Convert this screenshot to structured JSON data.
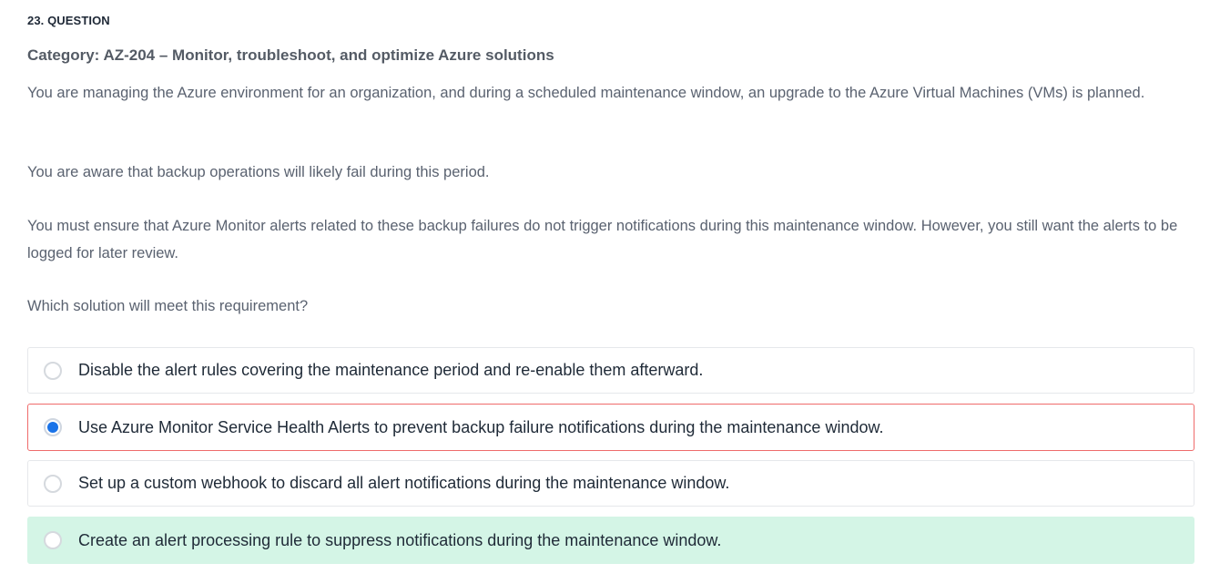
{
  "question": {
    "number_label": "23. QUESTION",
    "category": "Category: AZ-204 – Monitor, troubleshoot, and optimize Azure solutions",
    "paragraphs": [
      "You are managing the Azure environment for an organization, and during a scheduled maintenance window, an upgrade to the Azure Virtual Machines (VMs) is planned.",
      "You are aware that backup operations will likely fail during this period.",
      "You must ensure that Azure Monitor alerts related to these backup failures do not trigger notifications during this maintenance window. However, you still want the alerts to be logged for later review.",
      "Which solution will meet this requirement?"
    ]
  },
  "options": [
    {
      "label": "Disable the alert rules covering the maintenance period and re-enable them afterward.",
      "state": "default"
    },
    {
      "label": "Use Azure Monitor Service Health Alerts to prevent backup failure notifications during the maintenance window.",
      "state": "selected-incorrect"
    },
    {
      "label": "Set up a custom webhook to discard all alert notifications during the maintenance window.",
      "state": "default"
    },
    {
      "label": "Create an alert processing rule to suppress notifications during the maintenance window.",
      "state": "correct"
    }
  ],
  "colors": {
    "selected_radio": "#1a73e8",
    "incorrect_border": "#ef6b6b",
    "correct_background": "#d4f5e6"
  }
}
